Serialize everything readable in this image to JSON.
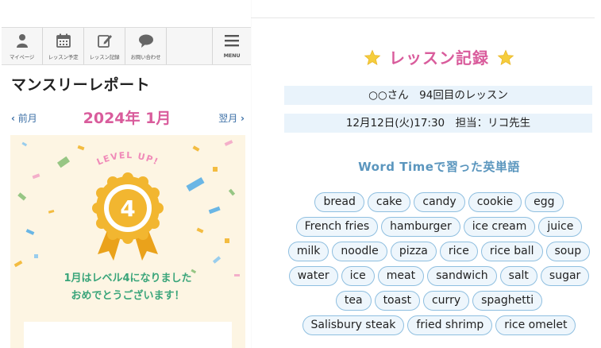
{
  "nav": {
    "items": [
      {
        "label": "マイページ",
        "icon": "person-icon"
      },
      {
        "label": "レッスン予定",
        "icon": "calendar-icon"
      },
      {
        "label": "レッスン記録",
        "icon": "edit-icon"
      },
      {
        "label": "お問い合わせ",
        "icon": "chat-bubble-icon"
      }
    ],
    "menu_label": "MENU"
  },
  "report": {
    "title": "マンスリーレポート",
    "prev_label": "前月",
    "next_label": "翌月",
    "month": "2024年 1月",
    "level_up_text": "LEVEL UP!",
    "level": "4",
    "message_line1": "1月はレベル4になりました",
    "message_line2": "おめでとうございます！",
    "colors": {
      "accent": "#d95c9c",
      "green": "#3aa57a",
      "badge": "#f2b630",
      "card_bg": "#fdf5e3"
    }
  },
  "record": {
    "title": "レッスン記録",
    "student_line": "○○さん　94回目のレッスン",
    "date_line": "12月12日(火)17:30　担当：リコ先生",
    "word_time_title": "Word Timeで習った英単語",
    "words": [
      "bread",
      "cake",
      "candy",
      "cookie",
      "egg",
      "French fries",
      "hamburger",
      "ice cream",
      "juice",
      "milk",
      "noodle",
      "pizza",
      "rice",
      "rice ball",
      "soup",
      "water",
      "ice",
      "meat",
      "sandwich",
      "salt",
      "sugar",
      "tea",
      "toast",
      "curry",
      "spaghetti",
      "Salisbury steak",
      "fried shrimp",
      "rice omelet"
    ],
    "colors": {
      "title": "#d95c9c",
      "info_bg": "#e9f3fb",
      "word_title": "#5b96be",
      "chip_border": "#8fbfe0"
    }
  }
}
